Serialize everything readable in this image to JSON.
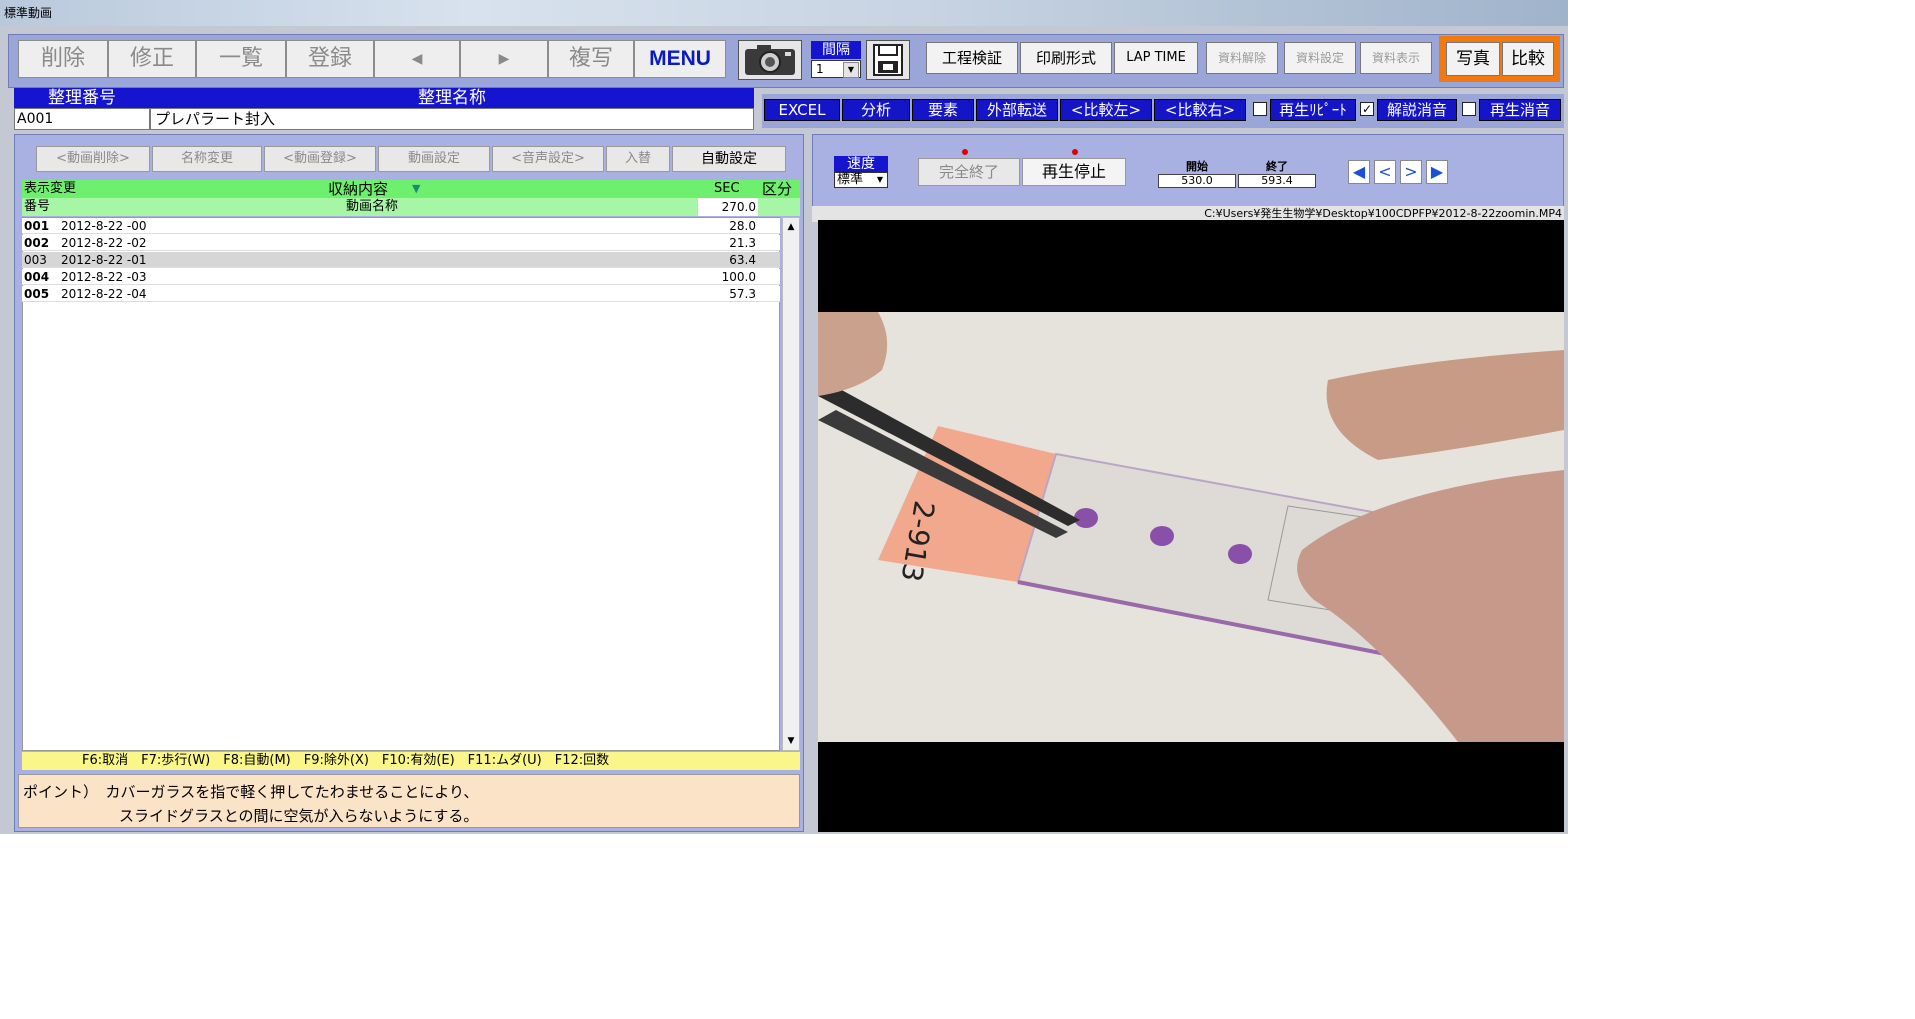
{
  "window": {
    "title": "標準動画"
  },
  "toolbar": {
    "buttons": [
      "削除",
      "修正",
      "一覧",
      "登録",
      "◀",
      "▶",
      "複写",
      "MENU"
    ],
    "interval_label": "間隔",
    "interval_value": "1",
    "right_buttons": [
      "工程検証",
      "印刷形式",
      "LAP TIME"
    ],
    "disabled_buttons": [
      "資料解除",
      "資料設定",
      "資料表示"
    ],
    "photo_label": "写真",
    "compare_label": "比較"
  },
  "record": {
    "number_header": "整理番号",
    "name_header": "整理名称",
    "number": "A001",
    "name": "プレパラート封入"
  },
  "actions": {
    "buttons": [
      "EXCEL",
      "分析",
      "要素",
      "外部転送",
      "<比較左>",
      "<比較右>"
    ],
    "checkboxes": [
      {
        "label": "再生ﾘﾋﾟｰﾄ",
        "checked": false
      },
      {
        "label": "解説消音",
        "checked": true
      },
      {
        "label": "再生消音",
        "checked": false
      }
    ]
  },
  "video_controls": {
    "buttons": [
      "<動画削除>",
      "名称変更",
      "<動画登録>",
      "動画設定",
      "<音声設定>",
      "入替",
      "自動設定"
    ]
  },
  "table": {
    "display_change": "表示変更",
    "storage_header": "収納内容",
    "sec_header": "SEC",
    "category_header": "区分",
    "number_header": "番号",
    "name_header": "動画名称",
    "total": "270.0",
    "rows": [
      {
        "no": "001",
        "name": "2012-8-22 -00",
        "sec": "28.0"
      },
      {
        "no": "002",
        "name": "2012-8-22 -02",
        "sec": "21.3"
      },
      {
        "no": "003",
        "name": "2012-8-22 -01",
        "sec": "63.4"
      },
      {
        "no": "004",
        "name": "2012-8-22 -03",
        "sec": "100.0"
      },
      {
        "no": "005",
        "name": "2012-8-22 -04",
        "sec": "57.3"
      }
    ]
  },
  "shortcuts": "F6:取消　F7:歩行(W)　F8:自動(M)　F9:除外(X)　F10:有効(E)　F11:ムダ(U)　F12:回数",
  "point": {
    "line1": "ポイント）　カバーガラスを指で軽く押してたわませることにより、",
    "line2": "スライドグラスとの間に空気が入らないようにする。"
  },
  "player": {
    "speed_label": "速度",
    "speed_value": "標準",
    "complete_button": "完全終了",
    "stop_button": "再生停止",
    "start_label": "開始",
    "end_label": "終了",
    "start_value": "530.0",
    "end_value": "593.4",
    "file_path": "C:¥Users¥発生生物学¥Desktop¥100CDPFP¥2012-8-22zoomin.MP4"
  }
}
